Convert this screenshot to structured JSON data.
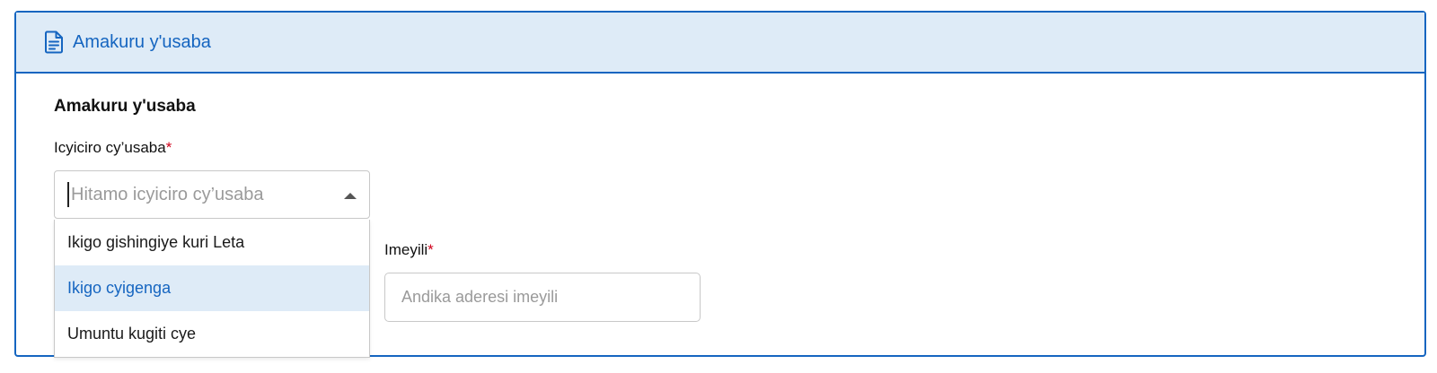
{
  "card": {
    "header_icon": "document-icon",
    "header_title": "Amakuru y'usaba",
    "accent_color": "#1565c0",
    "header_bg": "#deebf7"
  },
  "section": {
    "title": "Amakuru y'usaba"
  },
  "applicant_category": {
    "label": "Icyiciro cy’usaba",
    "required_mark": "*",
    "placeholder": "Hitamo icyiciro cy’usaba",
    "options": [
      "Ikigo gishingiye kuri Leta",
      "Ikigo cyigenga",
      "Umuntu kugiti cye"
    ],
    "highlighted_option": "Ikigo cyigenga"
  },
  "email": {
    "label": "Imeyili",
    "required_mark": "*",
    "placeholder": "Andika aderesi imeyili",
    "value": ""
  }
}
